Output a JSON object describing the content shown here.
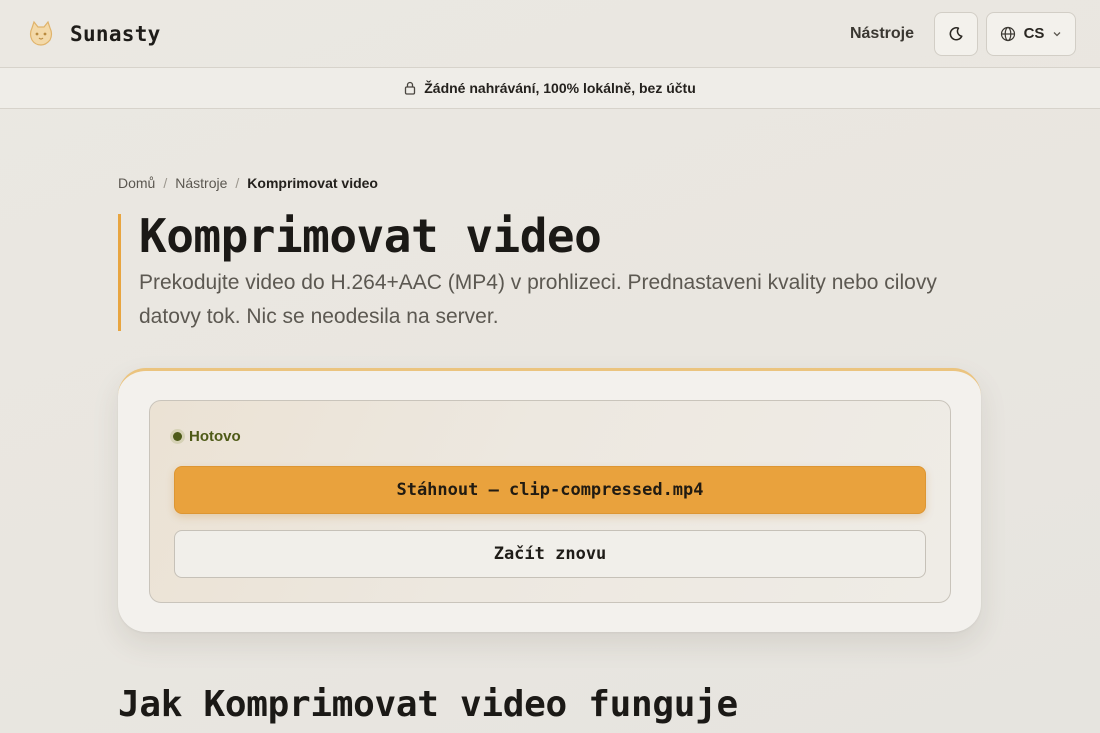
{
  "header": {
    "brand": "Sunasty",
    "nav_tools": "Nástroje",
    "language": "CS",
    "icons": {
      "logo": "cat-logo-icon",
      "theme": "moon-icon",
      "globe": "globe-icon",
      "chevron": "chevron-down-icon"
    }
  },
  "banner": {
    "text": "Žádné nahrávání, 100% lokálně, bez účtu",
    "icon": "lock-icon"
  },
  "breadcrumb": {
    "home": "Domů",
    "tools": "Nástroje",
    "current": "Komprimovat video",
    "separator": "/"
  },
  "hero": {
    "title": "Komprimovat video",
    "subtitle": "Prekodujte video do H.264+AAC (MP4) v prohlizeci. Prednastaveni kvality nebo cilovy datovy tok. Nic se neodesila na server."
  },
  "result": {
    "status": "Hotovo",
    "download_label": "Stáhnout — clip-compressed.mp4",
    "restart_label": "Začít znovu"
  },
  "section": {
    "how_title": "Jak Komprimovat video funguje"
  },
  "colors": {
    "accent": "#e9a23d",
    "status": "#4e5a17",
    "background": "#e9e6e0"
  }
}
